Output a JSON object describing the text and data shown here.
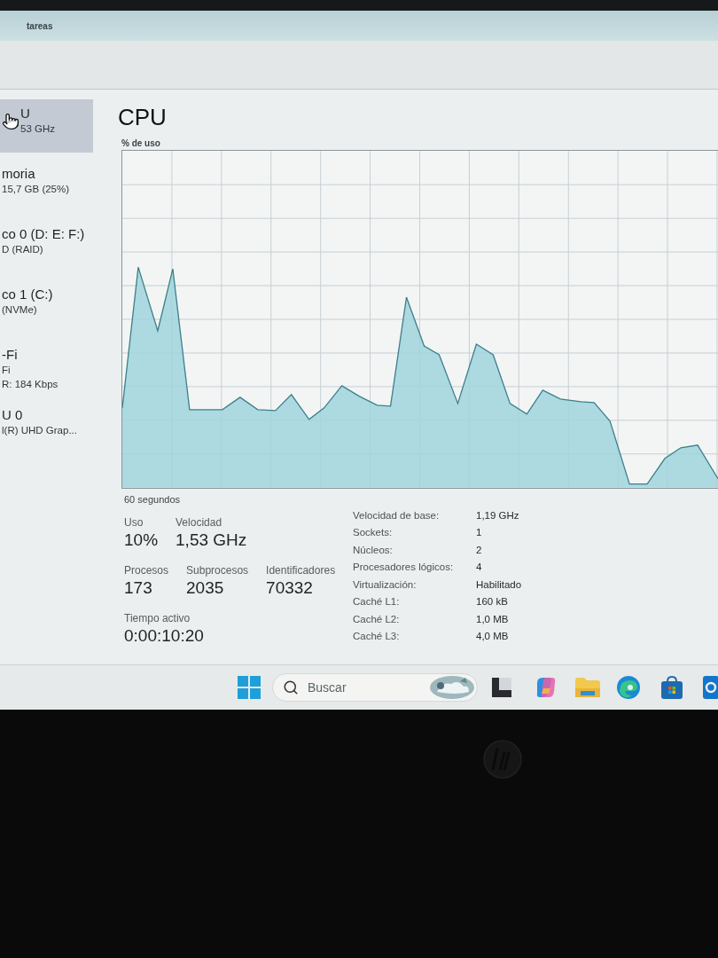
{
  "window": {
    "title": "tareas"
  },
  "sidebar": {
    "items": [
      {
        "title": "U",
        "details": [
          "53 GHz"
        ],
        "selected": true,
        "pointer": true
      },
      {
        "title": "moria",
        "details": [
          "15,7 GB (25%)"
        ],
        "selected": false,
        "pointer": false
      },
      {
        "title": "co 0 (D: E: F:)",
        "details": [
          "D (RAID)"
        ],
        "selected": false,
        "pointer": false
      },
      {
        "title": "co 1 (C:)",
        "details": [
          "(NVMe)"
        ],
        "selected": false,
        "pointer": false
      },
      {
        "title": "-Fi",
        "details": [
          "Fi",
          "R: 184 Kbps"
        ],
        "selected": false,
        "pointer": false
      },
      {
        "title": "U 0",
        "details": [
          "l(R) UHD Grap..."
        ],
        "selected": false,
        "pointer": false
      }
    ]
  },
  "main": {
    "heading": "CPU",
    "graph": {
      "title": "% de uso",
      "span": "60 segundos"
    },
    "stat_rows": [
      [
        {
          "label": "Uso",
          "value": "10%"
        },
        {
          "label": "Velocidad",
          "value": "1,53 GHz"
        }
      ],
      [
        {
          "label": "Procesos",
          "value": "173"
        },
        {
          "label": "Subprocesos",
          "value": "2035"
        },
        {
          "label": "Identificadores",
          "value": "70332"
        }
      ],
      [
        {
          "label": "Tiempo activo",
          "value": "0:00:10:20"
        }
      ]
    ],
    "specs": [
      {
        "label": "Velocidad de base:",
        "value": "1,19 GHz"
      },
      {
        "label": "Sockets:",
        "value": "1"
      },
      {
        "label": "Núcleos:",
        "value": "2"
      },
      {
        "label": "Procesadores lógicos:",
        "value": "4"
      },
      {
        "label": "Virtualización:",
        "value": "Habilitado"
      },
      {
        "label": "Caché L1:",
        "value": "160 kB"
      },
      {
        "label": "Caché L2:",
        "value": "1,0 MB"
      },
      {
        "label": "Caché L3:",
        "value": "4,0 MB"
      }
    ]
  },
  "taskbar": {
    "search": {
      "placeholder": "Buscar"
    }
  }
}
